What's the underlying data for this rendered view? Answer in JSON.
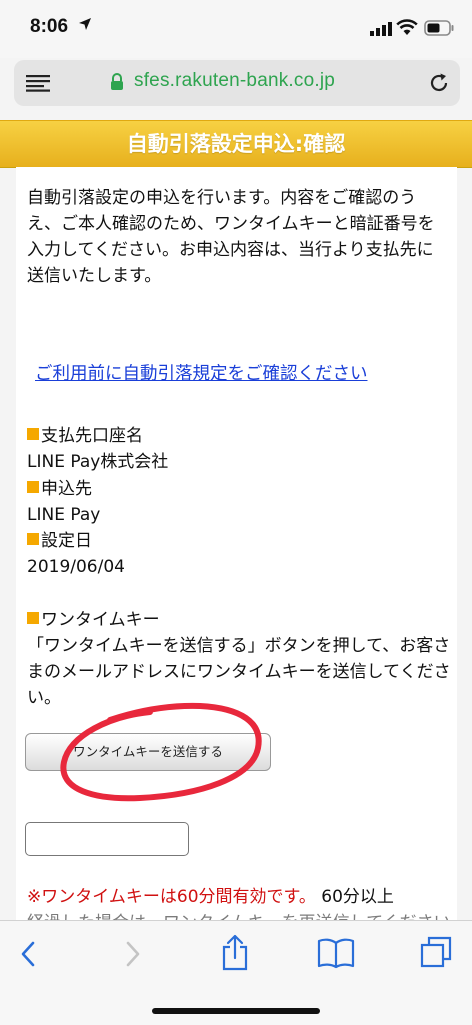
{
  "status_bar": {
    "time": "8:06"
  },
  "browser": {
    "url": "sfes.rakuten-bank.co.jp"
  },
  "banner": {
    "title": "自動引落設定申込:確認"
  },
  "content": {
    "intro": "自動引落設定の申込を行います。内容をご確認のうえ、ご本人確認のため、ワンタイムキーと暗証番号を入力してください。お申込内容は、当行より支払先に送信いたします。",
    "rules_link": "ご利用前に自動引落規定をご確認ください",
    "fields": [
      {
        "label": "支払先口座名",
        "value": "LINE Pay株式会社"
      },
      {
        "label": "申込先",
        "value": "LINE Pay"
      },
      {
        "label": "設定日",
        "value": "2019/06/04"
      }
    ],
    "otk": {
      "label": "ワンタイムキー",
      "instructions": "「ワンタイムキーを送信する」ボタンを押して、お客さまのメールアドレスにワンタイムキーを送信してください。",
      "send_button": "ワンタイムキーを送信する",
      "input_value": ""
    },
    "note": {
      "mark": "※",
      "red": "ワンタイムキーは60分間有効です。",
      "black": "60分以上",
      "next_line": "経過した場合は、ワンタイムキーを再送信してください。"
    }
  },
  "colors": {
    "banner": "#f0c030",
    "link": "#1a3fd8",
    "url": "#2ea44f",
    "note_red": "#d01010",
    "bullet": "#f5a800",
    "annotation": "#e8283c"
  },
  "icons": [
    "location-arrow-icon",
    "signal-icon",
    "wifi-icon",
    "battery-icon",
    "menu-icon",
    "lock-icon",
    "reload-icon",
    "back-icon",
    "forward-icon",
    "share-icon",
    "bookmarks-icon",
    "tabs-icon"
  ]
}
